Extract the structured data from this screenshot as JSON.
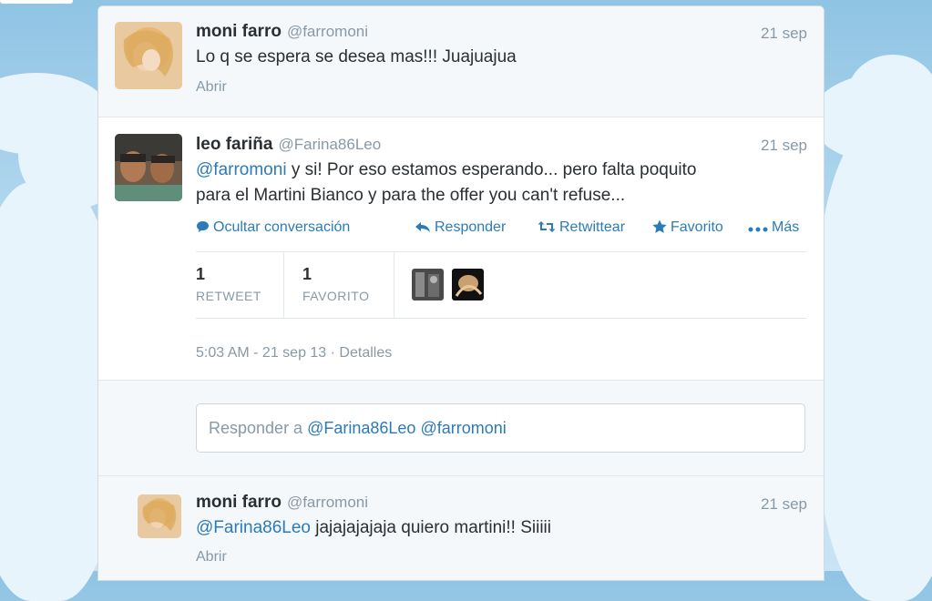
{
  "tweets": [
    {
      "name": "moni farro",
      "handle": "@farromoni",
      "time": "21 sep",
      "text": "Lo q se espera se desea mas!!! Juajuajua",
      "expand": "Abrir"
    },
    {
      "name": "leo fariña",
      "handle": "@Farina86Leo",
      "time": "21 sep",
      "mention": "@farromoni",
      "text_line1": " y si! Por eso estamos esperando... pero falta poquito",
      "text_line2": "para el Martini Bianco y para the offer you can't refuse...",
      "actions": {
        "hide": "Ocultar conversación",
        "reply": "Responder",
        "retweet": "Retwittear",
        "favorite": "Favorito",
        "more": "Más"
      },
      "stats": {
        "retweets": "1",
        "retweets_label": "RETWEET",
        "favorites": "1",
        "favorites_label": "FAVORITO"
      },
      "timestamp": "5:03 AM - 21 sep 13",
      "details": "Detalles"
    },
    {
      "name": "moni farro",
      "handle": "@farromoni",
      "time": "21 sep",
      "mention": "@Farina86Leo",
      "text": " jajajajajaja quiero martini!! Siiiii",
      "expand": "Abrir"
    }
  ],
  "reply_box": {
    "prefix": "Responder a ",
    "mention1": "@Farina86Leo",
    "mention2": "@farromoni"
  },
  "colors": {
    "link": "#2b7bb9",
    "muted": "#8899a6",
    "text": "#292f33",
    "background_sky": "#b3d8ef"
  },
  "icons": [
    "comment-icon",
    "reply-icon",
    "retweet-icon",
    "star-icon",
    "more-dots-icon"
  ]
}
